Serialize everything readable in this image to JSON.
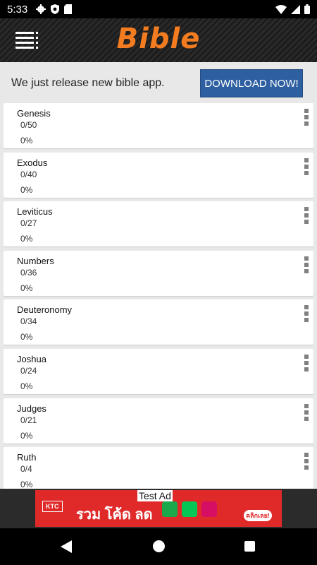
{
  "status_bar": {
    "time": "5:33"
  },
  "app_bar": {
    "title": "Bible"
  },
  "promo": {
    "text": "We just release new bible app.",
    "button_label": "DOWNLOAD NOW!"
  },
  "books": [
    {
      "name": "Genesis",
      "chapters": "0/50",
      "percent": "0%"
    },
    {
      "name": "Exodus",
      "chapters": "0/40",
      "percent": "0%"
    },
    {
      "name": "Leviticus",
      "chapters": "0/27",
      "percent": "0%"
    },
    {
      "name": "Numbers",
      "chapters": "0/36",
      "percent": "0%"
    },
    {
      "name": "Deuteronomy",
      "chapters": "0/34",
      "percent": "0%"
    },
    {
      "name": "Joshua",
      "chapters": "0/24",
      "percent": "0%"
    },
    {
      "name": "Judges",
      "chapters": "0/21",
      "percent": "0%"
    },
    {
      "name": "Ruth",
      "chapters": "0/4",
      "percent": "0%"
    }
  ],
  "ad": {
    "label": "Test Ad",
    "brand": "KTC",
    "headline": "รวม โค้ด ลด",
    "cta": "คลิกเลย!"
  },
  "colors": {
    "accent": "#f47c20",
    "button": "#2e5fa0",
    "ad_background": "#e02a2a"
  }
}
